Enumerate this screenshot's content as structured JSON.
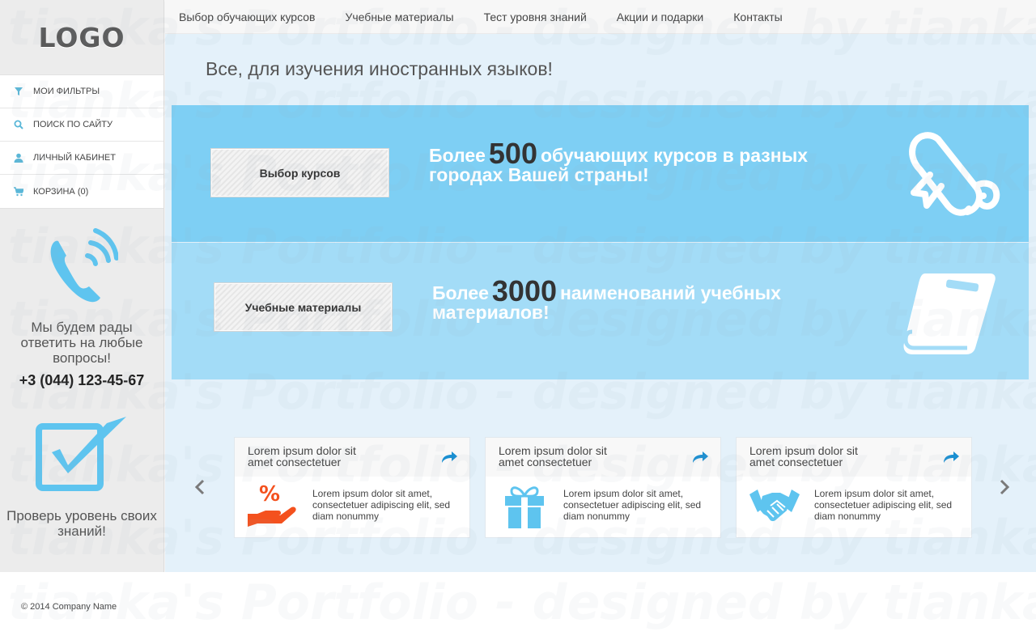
{
  "sidebar": {
    "logo": "LOGO",
    "menu": [
      {
        "label": "МОИ ФИЛЬТРЫ",
        "icon": "filter-icon"
      },
      {
        "label": "ПОИСК ПО САЙТУ",
        "icon": "search-icon"
      },
      {
        "label": "ЛИЧНЫЙ КАБИНЕТ",
        "icon": "user-icon"
      },
      {
        "label": "КОРЗИНА (0)",
        "icon": "cart-icon"
      }
    ],
    "call_text": "Мы будем рады ответить на любые вопросы!",
    "phone": "+3 (044) 123-45-67",
    "check_text": "Проверь уровень своих знаний!"
  },
  "topnav": [
    "Выбор обучающих курсов",
    "Учебные материалы",
    "Тест уровня знаний",
    "Акции и подарки",
    "Контакты"
  ],
  "page_title": "Все, для изучения иностранных языков!",
  "banners": [
    {
      "button": "Выбор курсов",
      "text_before": "Более",
      "number": "500",
      "text_after": "обучающих курсов в разных городах Вашей страны!",
      "icon": "diploma-icon"
    },
    {
      "button": "Учебные материалы",
      "text_before": "Более",
      "number": "3000",
      "text_after": "наименований учебных материалов!",
      "icon": "book-icon"
    }
  ],
  "cards": [
    {
      "title_line1": "Lorem ipsum dolor sit",
      "title_line2": "amet consectetuer",
      "text": "Lorem ipsum dolor sit amet, consectetuer adipiscing elit, sed diam nonummy",
      "icon": "discount-hand-icon"
    },
    {
      "title_line1": "Lorem ipsum dolor sit",
      "title_line2": "amet consectetuer",
      "text": "Lorem ipsum dolor sit amet, consectetuer adipiscing elit, sed diam nonummy",
      "icon": "gift-icon"
    },
    {
      "title_line1": "Lorem ipsum dolor sit",
      "title_line2": "amet consectetuer",
      "text": "Lorem ipsum dolor sit amet, consectetuer adipiscing elit, sed diam nonummy",
      "icon": "handshake-icon"
    }
  ],
  "footer": {
    "copyright": "© 2014 Company Name"
  },
  "watermark": "tianka's Portfolio - designed by tianka  tianka.design@gmail.com - site: tianka",
  "colors": {
    "banner1": "#7ecff4",
    "banner2": "#a3dcf7",
    "accent_icon": "#5ec4ef",
    "orange": "#f4511e",
    "share_blue": "#1a8fd1"
  }
}
